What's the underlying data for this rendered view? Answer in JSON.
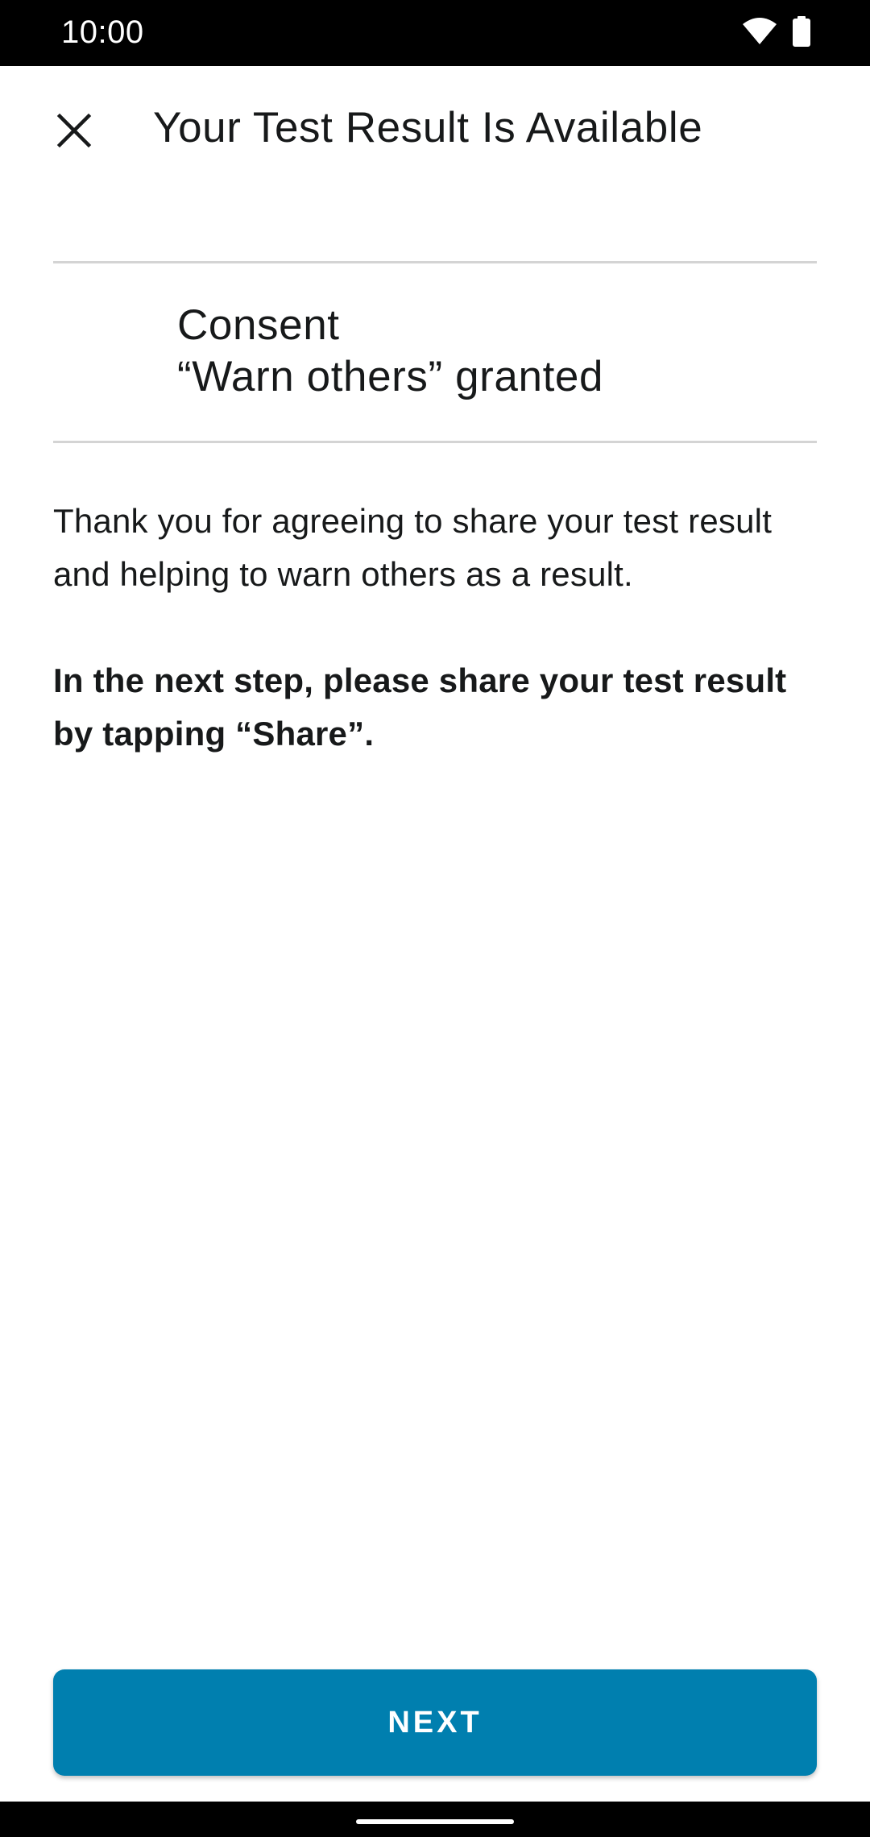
{
  "status_bar": {
    "time": "10:00",
    "icons": [
      "wifi-icon",
      "battery-icon"
    ]
  },
  "app_bar": {
    "close_icon": "close-icon",
    "title": "Your Test Result Is Available"
  },
  "consent": {
    "line1": "Consent",
    "line2": "“Warn others” granted"
  },
  "body": {
    "thanks": "Thank you for agreeing to share your test result and helping to warn others as a result.",
    "instruction": "In the next step, please share your test result by tapping “Share”."
  },
  "actions": {
    "next_label": "NEXT"
  },
  "colors": {
    "accent": "#007faf",
    "text": "#17191a",
    "divider": "#d4d4d4"
  }
}
